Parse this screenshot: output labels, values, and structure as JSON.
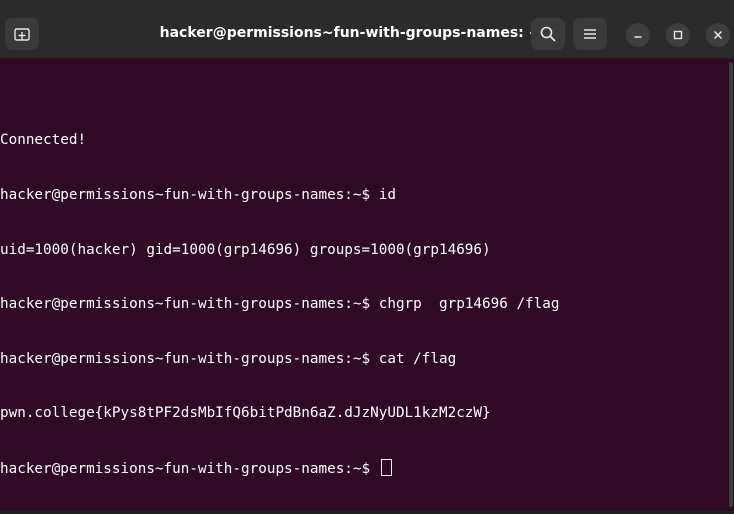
{
  "window": {
    "title": "hacker@permissions~fun-with-groups-names: ~"
  },
  "titlebar": {
    "new_tab_icon": "new-tab-icon",
    "search_icon": "search-icon",
    "menu_icon": "hamburger-menu-icon",
    "minimize_icon": "minimize-icon",
    "maximize_icon": "maximize-icon",
    "close_icon": "close-icon"
  },
  "terminal": {
    "lines": [
      "Connected!",
      "hacker@permissions~fun-with-groups-names:~$ id",
      "uid=1000(hacker) gid=1000(grp14696) groups=1000(grp14696)",
      "hacker@permissions~fun-with-groups-names:~$ chgrp  grp14696 /flag",
      "hacker@permissions~fun-with-groups-names:~$ cat /flag",
      "pwn.college{kPys8tPF2dsMbIfQ6bitPdBn6aZ.dJzNyUDL1kzM2czW}"
    ],
    "prompt": "hacker@permissions~fun-with-groups-names:~$ "
  },
  "colors": {
    "terminal_background": "#300a24",
    "titlebar_background": "#2b2b2b",
    "text": "#ffffff"
  }
}
